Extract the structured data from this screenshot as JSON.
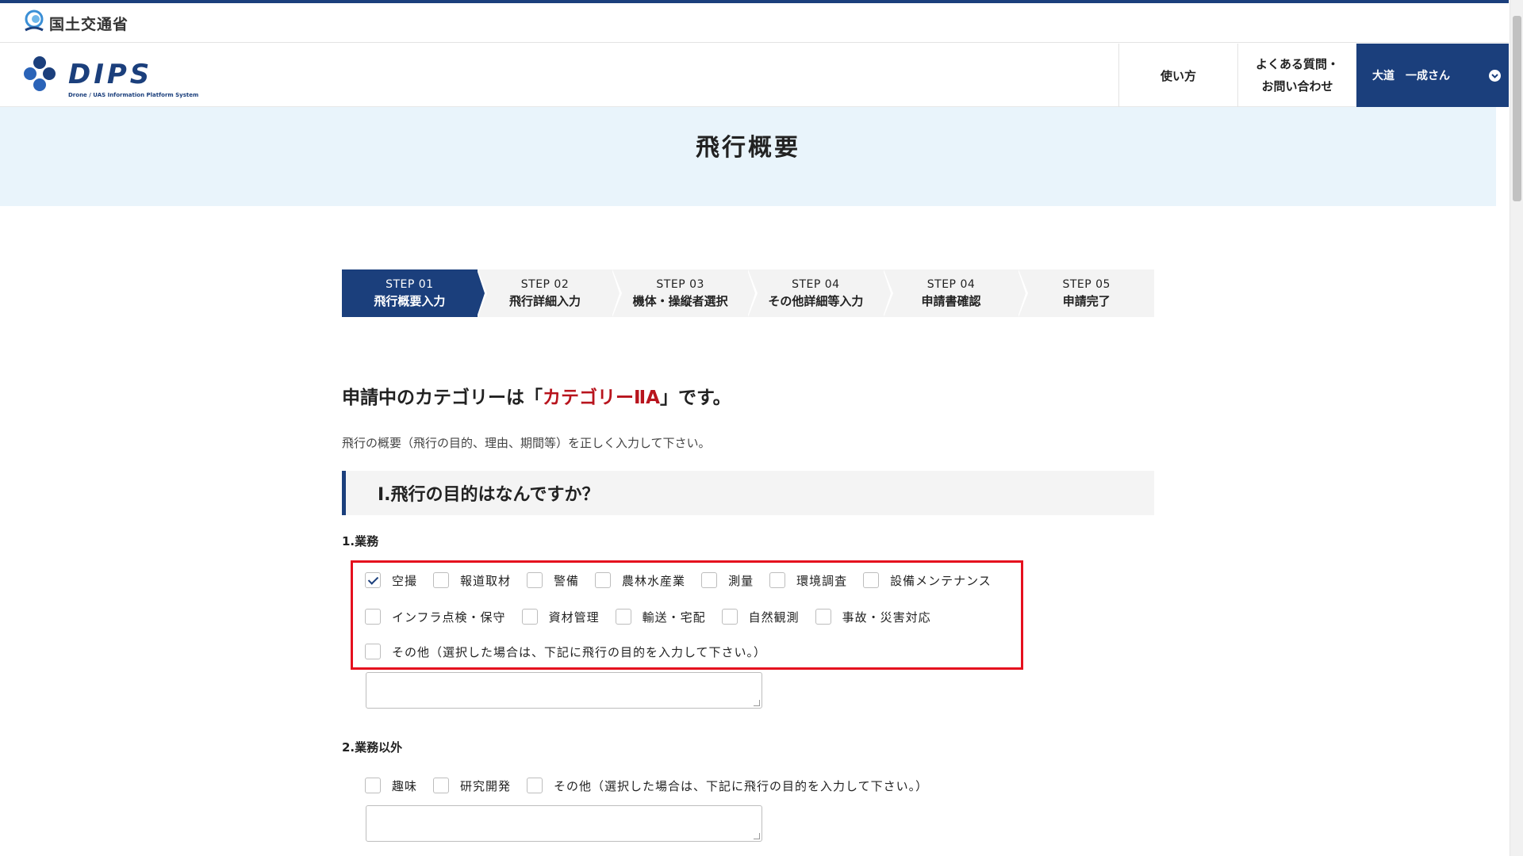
{
  "ministry": {
    "name": "国土交通省"
  },
  "header": {
    "logo_text": "DIPS",
    "logo_sub": "Drone / UAS Information Platform System",
    "nav_howto": "使い方",
    "nav_faq_line1": "よくある質問・",
    "nav_faq_line2": "お問い合わせ",
    "user_name": "大道　一成さん"
  },
  "page_title": "飛行概要",
  "steps": [
    {
      "num": "STEP 01",
      "label": "飛行概要入力",
      "active": true
    },
    {
      "num": "STEP 02",
      "label": "飛行詳細入力",
      "active": false
    },
    {
      "num": "STEP 03",
      "label": "機体・操縦者選択",
      "active": false
    },
    {
      "num": "STEP 04",
      "label": "その他詳細等入力",
      "active": false
    },
    {
      "num": "STEP 04",
      "label": "申請書確認",
      "active": false
    },
    {
      "num": "STEP 05",
      "label": "申請完了",
      "active": false
    }
  ],
  "category": {
    "prefix": "申請中のカテゴリーは「",
    "name": "カテゴリーⅡA",
    "suffix": "」です。"
  },
  "intro": "飛行の概要（飛行の目的、理由、期間等）を正しく入力して下さい。",
  "section1": {
    "title": "Ⅰ.飛行の目的はなんですか？",
    "business": {
      "label": "1.業務",
      "row1": [
        {
          "label": "空撮",
          "checked": true
        },
        {
          "label": "報道取材",
          "checked": false
        },
        {
          "label": "警備",
          "checked": false
        },
        {
          "label": "農林水産業",
          "checked": false
        },
        {
          "label": "測量",
          "checked": false
        },
        {
          "label": "環境調査",
          "checked": false
        },
        {
          "label": "設備メンテナンス",
          "checked": false
        }
      ],
      "row2": [
        {
          "label": "インフラ点検・保守",
          "checked": false
        },
        {
          "label": "資材管理",
          "checked": false
        },
        {
          "label": "輸送・宅配",
          "checked": false
        },
        {
          "label": "自然観測",
          "checked": false
        },
        {
          "label": "事故・災害対応",
          "checked": false
        }
      ],
      "row3": [
        {
          "label": "その他（選択した場合は、下記に飛行の目的を入力して下さい。）",
          "checked": false
        }
      ]
    },
    "non_business": {
      "label": "2.業務以外",
      "row1": [
        {
          "label": "趣味",
          "checked": false
        },
        {
          "label": "研究開発",
          "checked": false
        },
        {
          "label": "その他（選択した場合は、下記に飛行の目的を入力して下さい。）",
          "checked": false
        }
      ]
    }
  },
  "colors": {
    "navy": "#1b3f7c",
    "accent_red": "#b8141d",
    "highlight_border": "#e5101e",
    "band": "#e9f4fb"
  }
}
